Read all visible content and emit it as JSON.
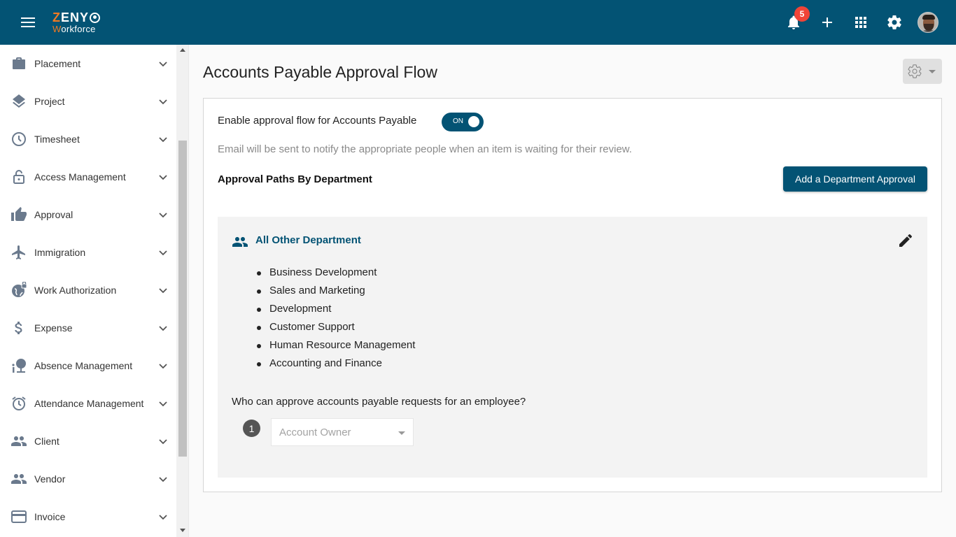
{
  "header": {
    "logo_top": "ZENY",
    "logo_top_accent": "Z",
    "logo_bottom": "Workforce",
    "logo_bottom_accent": "W",
    "notification_count": "5",
    "icons": [
      "menu-icon",
      "bell-icon",
      "plus-icon",
      "apps-grid-icon",
      "gear-icon",
      "user-avatar"
    ]
  },
  "sidebar": {
    "items": [
      {
        "label": "Placement",
        "icon": "briefcase-icon"
      },
      {
        "label": "Project",
        "icon": "layers-icon"
      },
      {
        "label": "Timesheet",
        "icon": "clock-icon"
      },
      {
        "label": "Access Management",
        "icon": "lock-open-icon"
      },
      {
        "label": "Approval",
        "icon": "thumbs-up-icon"
      },
      {
        "label": "Immigration",
        "icon": "airplane-icon"
      },
      {
        "label": "Work Authorization",
        "icon": "globe-lock-icon"
      },
      {
        "label": "Expense",
        "icon": "dollar-icon"
      },
      {
        "label": "Absence Management",
        "icon": "beach-icon"
      },
      {
        "label": "Attendance Management",
        "icon": "alarm-clock-icon"
      },
      {
        "label": "Client",
        "icon": "people-icon"
      },
      {
        "label": "Vendor",
        "icon": "people-icon"
      },
      {
        "label": "Invoice",
        "icon": "credit-card-icon"
      }
    ]
  },
  "main": {
    "title": "Accounts Payable Approval Flow",
    "enable_label": "Enable approval flow for Accounts Payable",
    "toggle_state": "ON",
    "note": "Email will be sent to notify the appropriate people when an item is waiting for their review.",
    "section_title": "Approval Paths By Department",
    "add_button": "Add a Department Approval",
    "department": {
      "title": "All Other Department",
      "items": [
        "Business Development",
        "Sales and Marketing",
        "Development",
        "Customer Support",
        "Human Resource Management",
        "Accounting and Finance"
      ],
      "question": "Who can approve accounts payable requests for an employee?",
      "steps": [
        {
          "number": "1",
          "approver": "Account Owner"
        }
      ]
    }
  },
  "colors": {
    "brand": "#035374",
    "accent": "#f07a22",
    "badge": "#f04438"
  }
}
